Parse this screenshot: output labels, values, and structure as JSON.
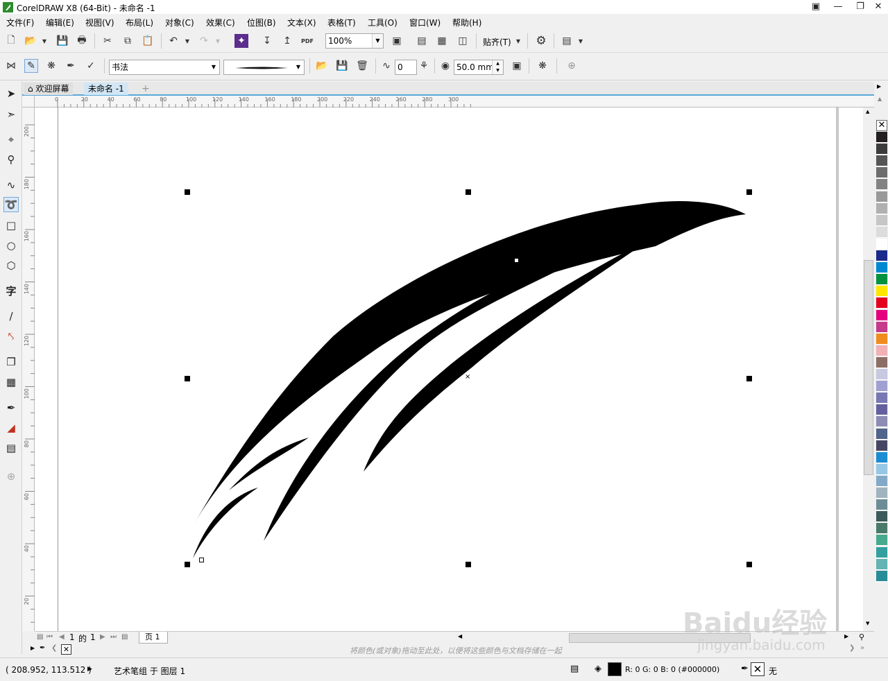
{
  "window": {
    "title": "CorelDRAW X8 (64-Bit) - 未命名 -1"
  },
  "menu": [
    "文件(F)",
    "编辑(E)",
    "视图(V)",
    "布局(L)",
    "对象(C)",
    "效果(C)",
    "位图(B)",
    "文本(X)",
    "表格(T)",
    "工具(O)",
    "窗口(W)",
    "帮助(H)"
  ],
  "toolbar": {
    "zoom_value": "100%",
    "snap_label": "贴齐(T)",
    "pdf_label": "PDF"
  },
  "property_bar": {
    "brush_category": "书法",
    "smoothing_value": "0",
    "stroke_width": "50.0 mm"
  },
  "tabs": {
    "welcome": "欢迎屏幕",
    "document": "未命名 -1",
    "add": "+"
  },
  "rulers": {
    "horizontal": [
      "0",
      "20",
      "40",
      "60",
      "80",
      "100",
      "120",
      "140",
      "160",
      "180",
      "200",
      "220",
      "240",
      "260",
      "280",
      "300"
    ],
    "vertical": [
      "200",
      "180",
      "160",
      "140",
      "120",
      "100",
      "80",
      "60",
      "40",
      "20"
    ]
  },
  "page_nav": {
    "current": "1",
    "of_label": "的",
    "total": "1",
    "page_tab": "页 1"
  },
  "colorbar_hint": "将颜色(或对象)拖动至此处，以便将这些颜色与文档存储在一起",
  "palette": [
    "#231f20",
    "#3c3c3c",
    "#555555",
    "#6d6d6d",
    "#828282",
    "#999999",
    "#b0b0b0",
    "#c6c6c6",
    "#dcdcdc",
    "#ffffff",
    "#1b2a8a",
    "#0088d0",
    "#00923f",
    "#ffe600",
    "#e6001f",
    "#e4007f",
    "#c53a8a",
    "#f08c1e",
    "#f3b0b5",
    "#8c6e64",
    "#c8c8e0",
    "#a0a0d2",
    "#7878b4",
    "#6460a0",
    "#8c8cb4",
    "#50648c",
    "#464664",
    "#1e8cd2",
    "#96c8e6",
    "#82aac8",
    "#a0b4be",
    "#6e8c96",
    "#3c5a5a",
    "#4a7a6a",
    "#46aa8c",
    "#32a0a0",
    "#64b4b4",
    "#288c96"
  ],
  "status": {
    "coords": "( 208.952, 113.512 )",
    "object_info": "艺术笔组 于 图层 1",
    "fill_info": "R: 0 G: 0 B: 0 (#000000)",
    "outline_info": "无"
  },
  "watermark": {
    "brand": "Baidu经验",
    "url": "jingyan.baidu.com"
  }
}
